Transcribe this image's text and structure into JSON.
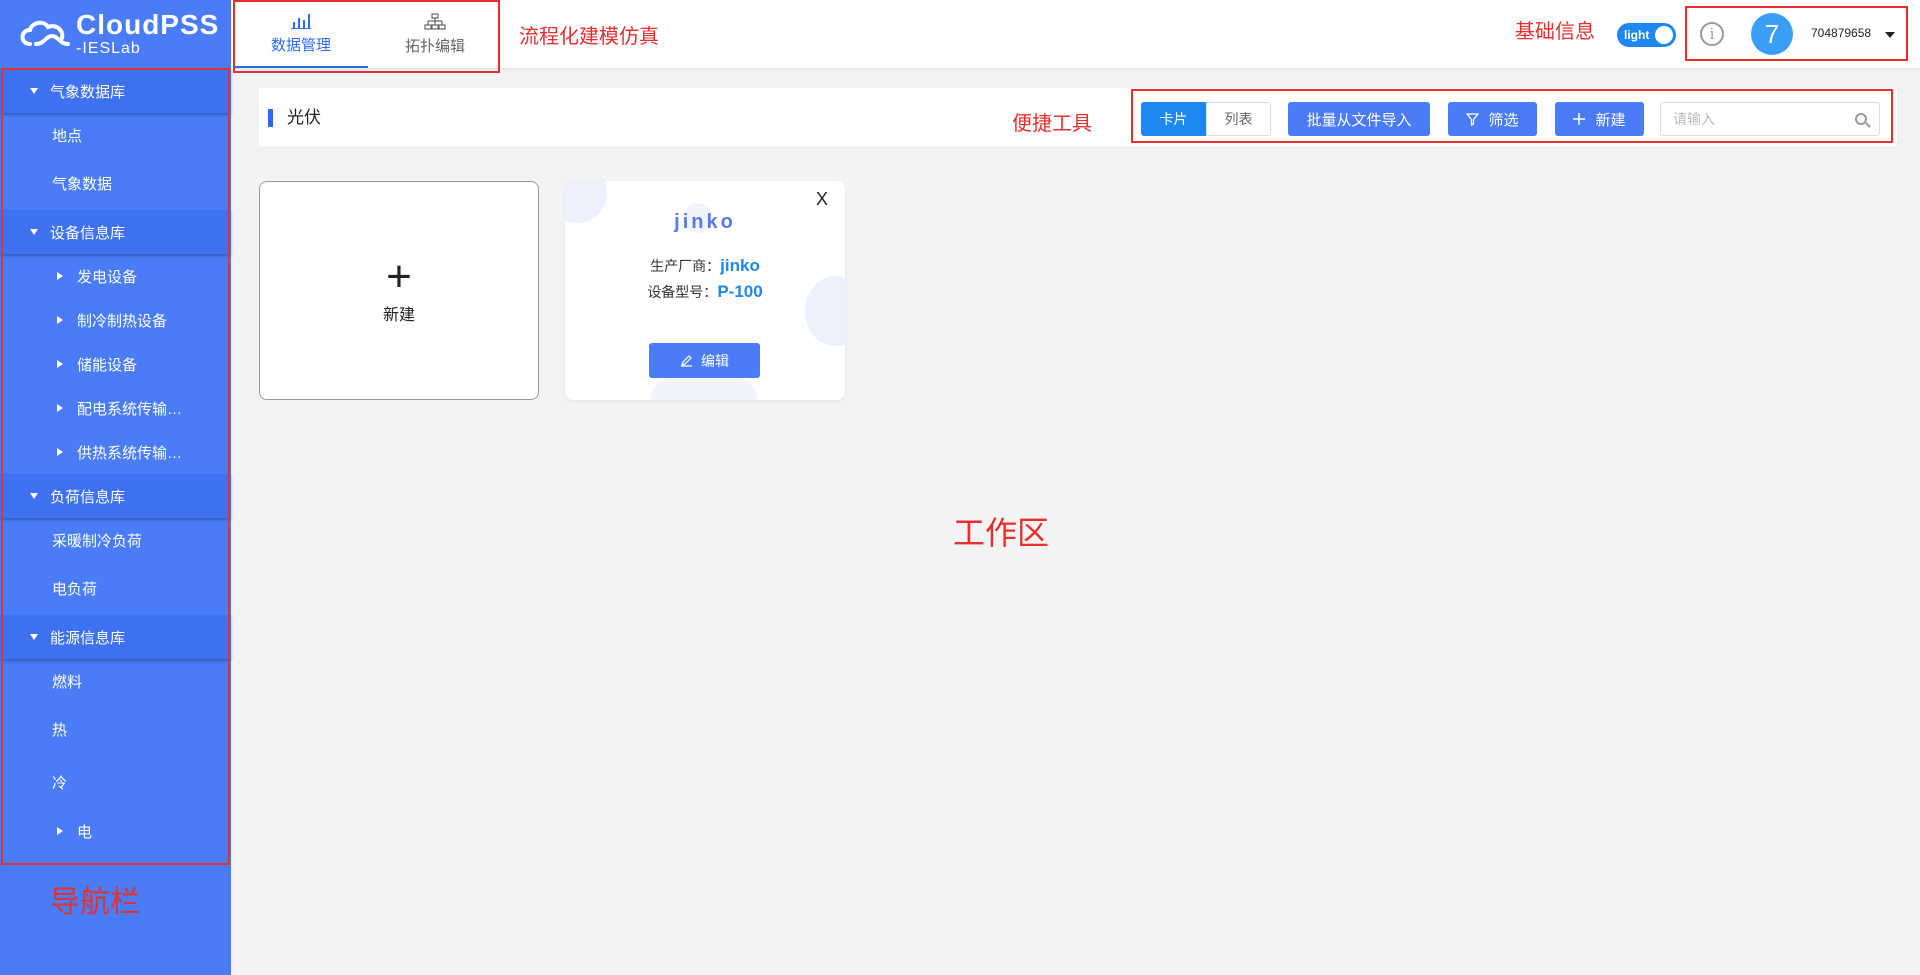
{
  "logo": {
    "line1": "CloudPSS",
    "line2": "-IESLab"
  },
  "sidebar": {
    "groups": [
      {
        "label": "气象数据库",
        "items": [
          "地点",
          "气象数据"
        ]
      },
      {
        "label": "设备信息库",
        "subitems": [
          "发电设备",
          "制冷制热设备",
          "储能设备",
          "配电系统传输…",
          "供热系统传输…"
        ]
      },
      {
        "label": "负荷信息库",
        "items": [
          "采暖制冷负荷",
          "电负荷"
        ]
      },
      {
        "label": "能源信息库",
        "items": [
          "燃料",
          "热",
          "冷"
        ],
        "subitems": [
          "电"
        ]
      }
    ]
  },
  "topbar": {
    "tabs": [
      {
        "label": "数据管理",
        "active": true
      },
      {
        "label": "拓扑编辑",
        "active": false
      }
    ],
    "theme_toggle": "light",
    "info_icon": "i",
    "avatar": "7",
    "username": "704879658"
  },
  "toolbar": {
    "title": "光伏",
    "view_card": "卡片",
    "view_list": "列表",
    "import_label": "批量从文件导入",
    "filter_label": "筛选",
    "new_label": "新建",
    "search_placeholder": "请输入",
    "search_value": ""
  },
  "cards": {
    "new_card_label": "新建",
    "items": [
      {
        "name": "jinko",
        "manufacturer_label": "生产厂商：",
        "manufacturer": "jinko",
        "model_label": "设备型号：",
        "model": "P-100",
        "edit_label": "编辑",
        "close": "X"
      }
    ]
  },
  "annotations": {
    "workflow": "流程化建模仿真",
    "basic_info": "基础信息",
    "quick_tools": "便捷工具",
    "workspace": "工作区",
    "navbar": "导航栏"
  },
  "colors": {
    "sidebar": "#4a7cf7",
    "primary": "#1e88f0",
    "annotation": "#e53030"
  }
}
